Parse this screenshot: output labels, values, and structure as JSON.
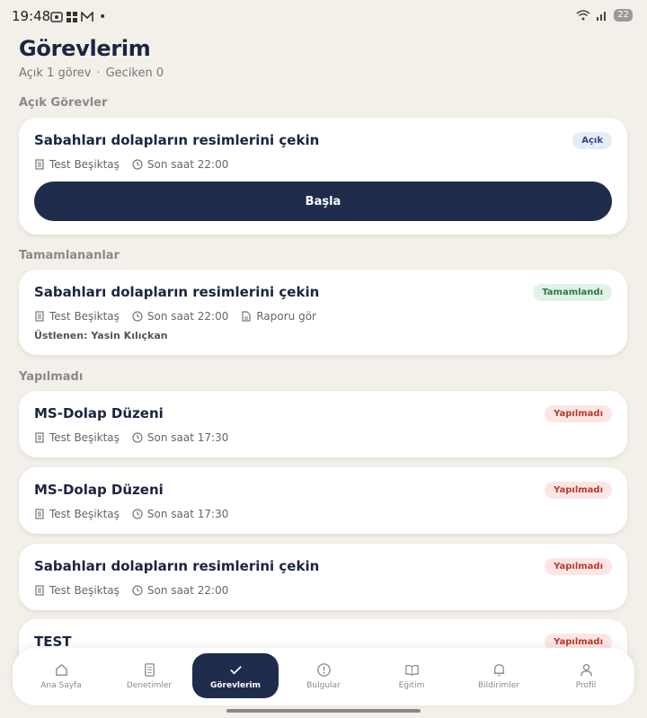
{
  "status_bar": {
    "time": "19:48",
    "battery": "22"
  },
  "header": {
    "title": "Görevlerim",
    "open_summary": "Açık 1 görev",
    "separator": "·",
    "late_summary": "Geciken 0"
  },
  "sections": {
    "open": {
      "label": "Açık Görevler",
      "tasks": [
        {
          "title": "Sabahları dolapların resimlerini çekin",
          "badge": "Açık",
          "location": "Test Beşiktaş",
          "deadline": "Son saat 22:00",
          "action": "Başla"
        }
      ]
    },
    "completed": {
      "label": "Tamamlananlar",
      "tasks": [
        {
          "title": "Sabahları dolapların resimlerini çekin",
          "badge": "Tamamlandı",
          "location": "Test Beşiktaş",
          "deadline": "Son saat 22:00",
          "report": "Raporu gör",
          "assignee": "Üstlenen: Yasin Kılıçkan"
        }
      ]
    },
    "missed": {
      "label": "Yapılmadı",
      "tasks": [
        {
          "title": "MS-Dolap Düzeni",
          "badge": "Yapılmadı",
          "location": "Test Beşiktaş",
          "deadline": "Son saat 17:30"
        },
        {
          "title": "MS-Dolap Düzeni",
          "badge": "Yapılmadı",
          "location": "Test Beşiktaş",
          "deadline": "Son saat 17:30"
        },
        {
          "title": "Sabahları dolapların resimlerini çekin",
          "badge": "Yapılmadı",
          "location": "Test Beşiktaş",
          "deadline": "Son saat 22:00"
        },
        {
          "title": "TEST",
          "badge": "Yapılmadı"
        }
      ]
    }
  },
  "bottom_nav": [
    {
      "label": "Ana Sayfa",
      "icon": "home-icon"
    },
    {
      "label": "Denetimler",
      "icon": "document-icon"
    },
    {
      "label": "Görevlerim",
      "icon": "check-icon",
      "active": true
    },
    {
      "label": "Bulgular",
      "icon": "alert-icon"
    },
    {
      "label": "Eğitim",
      "icon": "book-icon"
    },
    {
      "label": "Bildirimler",
      "icon": "bell-icon"
    },
    {
      "label": "Profil",
      "icon": "user-icon"
    }
  ],
  "colors": {
    "background": "#f3f0e9",
    "primary": "#1f2c4c",
    "open_badge": "#e4ecf8",
    "done_badge": "#e1f3e6",
    "missed_badge": "#fbe6e4"
  }
}
